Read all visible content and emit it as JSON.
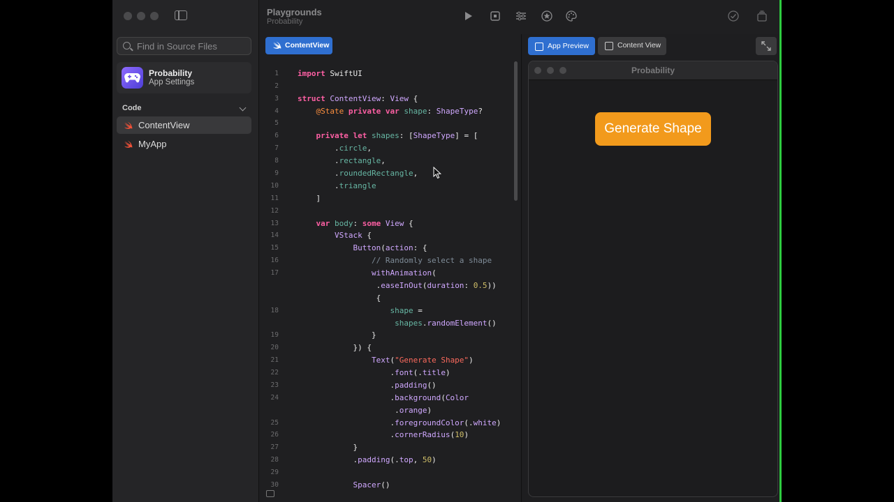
{
  "window": {
    "title": "Playgrounds",
    "subtitle": "Probability"
  },
  "sidebar": {
    "search_placeholder": "Find in Source Files",
    "app": {
      "name": "Probability",
      "subtitle": "App Settings"
    },
    "section_title": "Code",
    "files": [
      {
        "label": "ContentView",
        "selected": true
      },
      {
        "label": "MyApp",
        "selected": false
      }
    ]
  },
  "editor": {
    "tab_label": "ContentView",
    "line_numbers": [
      "1",
      "2",
      "3",
      "4",
      "5",
      "6",
      "7",
      "8",
      "9",
      "10",
      "11",
      "12",
      "13",
      "14",
      "15",
      "16",
      "17",
      "",
      "",
      "18",
      "",
      "19",
      "20",
      "21",
      "22",
      "23",
      "24",
      "",
      "25",
      "26",
      "27",
      "28",
      "29",
      "30"
    ]
  },
  "preview": {
    "tab_app_preview": "App Preview",
    "tab_content_view": "Content View",
    "window_title": "Probability",
    "button_label": "Generate Shape"
  },
  "colors": {
    "accent": "#2f6fd0",
    "button": "#f29a1c",
    "keyword": "#fc5fa3",
    "type": "#d0a8ff",
    "identifier": "#67b7a4",
    "string": "#fc6a5d",
    "comment": "#7f8c98",
    "number": "#d0bf69"
  }
}
